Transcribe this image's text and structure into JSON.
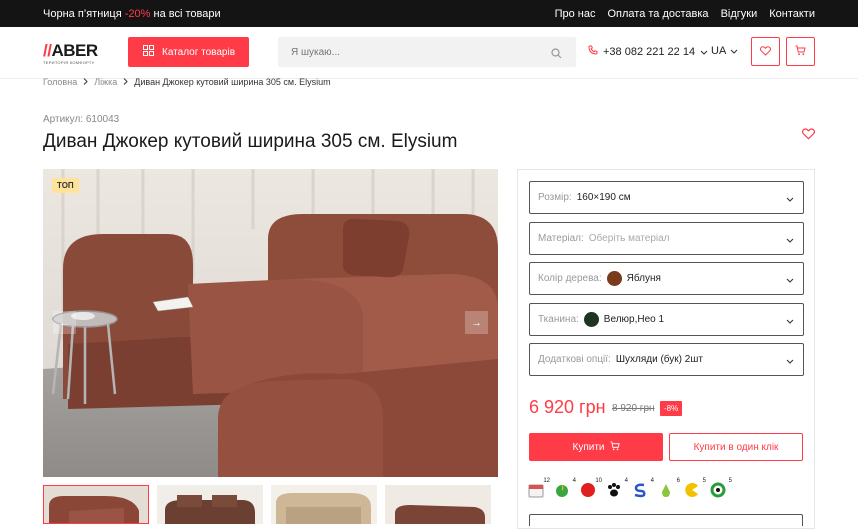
{
  "topbar": {
    "promo_prefix": "Чорна п’ятниця",
    "promo_highlight": "-20%",
    "promo_suffix": "на всі товари",
    "links": [
      "Про нас",
      "Оплата та доставка",
      "Відгуки",
      "Контакти"
    ]
  },
  "header": {
    "logo_text": "ABER",
    "logo_tagline": "ТЕРИТОРІЯ КОМФОРТУ",
    "catalog_label": "Каталог товарів",
    "search_placeholder": "Я шукаю...",
    "phone": "+38 082 221 22 14",
    "language": "UA"
  },
  "breadcrumb": [
    "Головна",
    "Ліжка",
    "Диван Джокер кутовий ширина 305 см. Elysium"
  ],
  "product": {
    "article": "Артикул: 610043",
    "title": "Диван Джокер кутовий ширина 305 см. Elysium",
    "badge": "ТОП",
    "price": "6 920 грн",
    "old_price": "8 920 грн",
    "discount": "-8%",
    "buy_label": "Купити",
    "one_click_label": "Купити в один клік"
  },
  "options": [
    {
      "label": "Розмір:",
      "value": "160×190 см",
      "placeholder": false,
      "swatch": null
    },
    {
      "label": "Матеріал:",
      "value": "Оберіть матеріал",
      "placeholder": true,
      "swatch": null
    },
    {
      "label": "Колір дерева:",
      "value": "Яблуня",
      "placeholder": false,
      "swatch": "#7a3a1c"
    },
    {
      "label": "Тканина:",
      "value": "Велюр,Нео 1",
      "placeholder": false,
      "swatch": "#1f3524"
    },
    {
      "label": "Додаткові опції:",
      "value": "Шухляди (бук) 2шт",
      "placeholder": false,
      "swatch": null
    }
  ],
  "payment_badges": [
    {
      "icon": "calendar-icon",
      "count": "12",
      "color": "#d9534f"
    },
    {
      "icon": "green-leaf-icon",
      "count": "4",
      "color": "#3aa642"
    },
    {
      "icon": "red-circle-icon",
      "count": "10",
      "color": "#e02020"
    },
    {
      "icon": "paw-icon",
      "count": "4",
      "color": "#111111"
    },
    {
      "icon": "s-logo-icon",
      "count": "4",
      "color": "#2a56c6"
    },
    {
      "icon": "pear-icon",
      "count": "6",
      "color": "#8cc63f"
    },
    {
      "icon": "pacman-icon",
      "count": "5",
      "color": "#f2c200"
    },
    {
      "icon": "green-c-icon",
      "count": "5",
      "color": "#2a9d3a"
    }
  ],
  "colors": {
    "accent": "#ff3b47",
    "topbar": "#141414"
  }
}
